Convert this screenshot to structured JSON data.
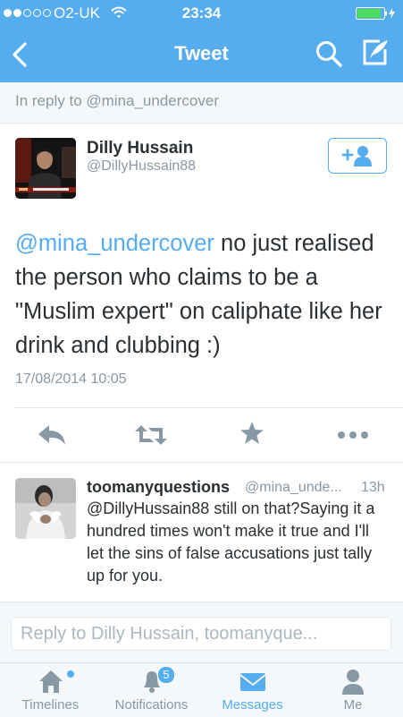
{
  "status_bar": {
    "carrier": "O2-UK",
    "time": "23:34",
    "signal_bars_filled": 2,
    "signal_bars_total": 5
  },
  "nav": {
    "title": "Tweet"
  },
  "reply_context": "In reply to @mina_undercover",
  "tweet": {
    "author_name": "Dilly Hussain",
    "author_handle": "@DillyHussain88",
    "mention": "@mina_undercover",
    "text": " no just realised the person who claims to be a \"Muslim expert\" on caliphate like her drink and clubbing :)",
    "timestamp": "17/08/2014 10:05"
  },
  "replies": [
    {
      "author_name": "toomanyquestions",
      "author_handle": "@mina_unde...",
      "age": "13h",
      "text": "@DillyHussain88 still on that?Saying it a hundred times won't make it true and I'll let the sins of false accusations just tally up for you."
    }
  ],
  "compose": {
    "placeholder": "Reply to Dilly Hussain, toomanyque..."
  },
  "tabs": [
    {
      "label": "Timelines",
      "icon": "home-icon"
    },
    {
      "label": "Notifications",
      "icon": "bell-icon",
      "badge": "5"
    },
    {
      "label": "Messages",
      "icon": "envelope-icon"
    },
    {
      "label": "Me",
      "icon": "person-icon"
    }
  ],
  "colors": {
    "accent": "#55acee",
    "text": "#292f33",
    "muted": "#8899a6",
    "battery": "#4cd964"
  }
}
